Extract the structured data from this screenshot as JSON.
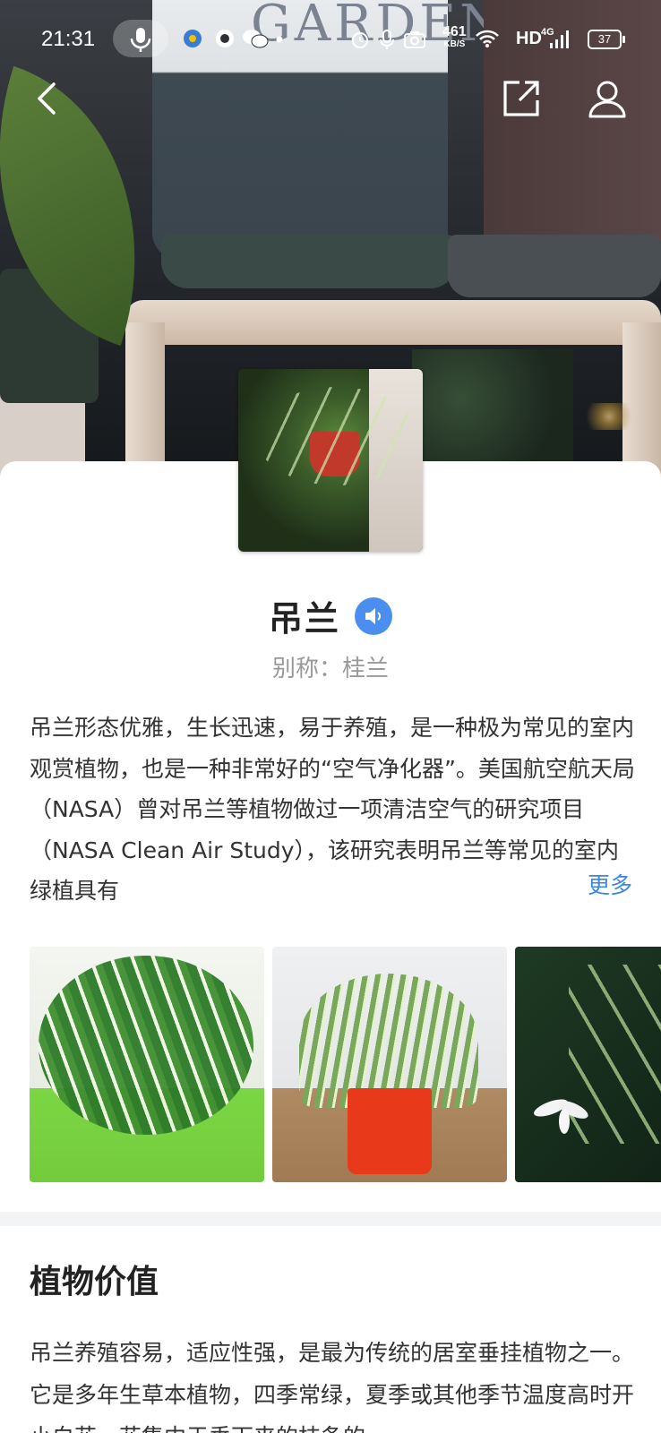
{
  "status_bar": {
    "time": "21:31",
    "net_speed_value": "461",
    "net_speed_unit": "KB/S",
    "hd": "HD",
    "network": "4G",
    "battery": "37"
  },
  "hero": {
    "pot_text": "GARDEN"
  },
  "plant": {
    "name": "吊兰",
    "alias": "别称：桂兰",
    "description": "吊兰形态优雅，生长迅速，易于养殖，是一种极为常见的室内观赏植物，也是一种非常好的“空气净化器”。美国航空航天局（NASA）曾对吊兰等植物做过一项清洁空气的研究项目（NASA Clean Air Study），该研究表明吊兰等常见的室内绿植具有",
    "more_label": "更多"
  },
  "section": {
    "title": "植物价值",
    "body": "吊兰养殖容易，适应性强，是最为传统的居室垂挂植物之一。它是多年生草本植物，四季常绿，夏季或其他季节温度高时开小白花，花集中于垂下来的枝条的"
  },
  "colors": {
    "accent": "#3a86e8",
    "speaker_bg": "#4a8ff0",
    "divider": "#f3f4f6"
  },
  "icons": [
    "back-icon",
    "share-icon",
    "user-icon",
    "speaker-icon",
    "mic-icon",
    "alarm-icon",
    "camera-icon",
    "wifi-icon",
    "signal-icon",
    "battery-icon"
  ]
}
